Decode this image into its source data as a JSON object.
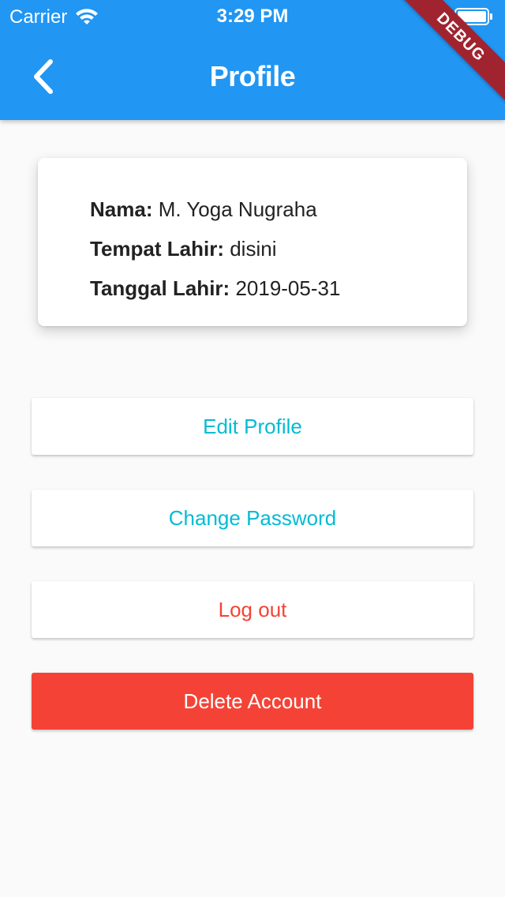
{
  "status_bar": {
    "carrier": "Carrier",
    "time": "3:29 PM"
  },
  "app_bar": {
    "title": "Profile",
    "back_icon": "chevron-left-icon",
    "color": "#2196f3"
  },
  "debug_banner": "DEBUG",
  "profile": {
    "nama_label": "Nama:",
    "nama_value": "M. Yoga Nugraha",
    "tempat_label": "Tempat Lahir:",
    "tempat_value": "disini",
    "tanggal_label": "Tanggal Lahir:",
    "tanggal_value": "2019-05-31"
  },
  "buttons": {
    "edit_profile": "Edit Profile",
    "change_password": "Change Password",
    "log_out": "Log out",
    "delete_account": "Delete Account"
  },
  "colors": {
    "accent": "#00bcd4",
    "danger": "#f44336",
    "background": "#fafafa"
  }
}
